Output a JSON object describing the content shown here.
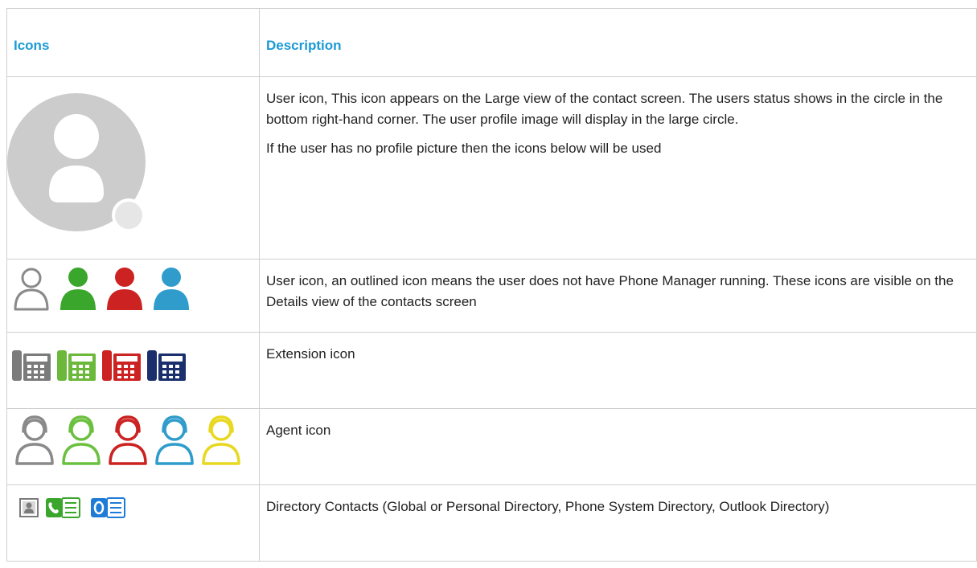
{
  "table": {
    "headers": {
      "icons": "Icons",
      "description": "Description"
    },
    "rows": [
      {
        "icon_set": [
          "user-profile-large-icon"
        ],
        "paragraphs": [
          "User icon, This icon appears on the Large view of the contact screen. The users status shows in the circle in the bottom right-hand corner. The user profile image will display in the large circle.",
          "If the user has no profile picture then the icons below will be used"
        ]
      },
      {
        "icon_set": [
          "user-outline-grey-icon",
          "user-green-icon",
          "user-red-icon",
          "user-blue-icon"
        ],
        "paragraphs": [
          "User icon, an outlined icon means the user does not have Phone Manager running. These icons are visible on the Details view of the contacts screen"
        ]
      },
      {
        "icon_set": [
          "extension-grey-icon",
          "extension-green-icon",
          "extension-red-icon",
          "extension-navy-icon"
        ],
        "paragraphs": [
          "Extension icon"
        ]
      },
      {
        "icon_set": [
          "agent-grey-icon",
          "agent-green-icon",
          "agent-red-icon",
          "agent-blue-icon",
          "agent-yellow-icon"
        ],
        "paragraphs": [
          "Agent icon"
        ]
      },
      {
        "icon_set": [
          "directory-contact-icon",
          "phone-system-directory-icon",
          "outlook-directory-icon"
        ],
        "paragraphs": [
          "Directory Contacts (Global or Personal Directory, Phone System Directory, Outlook Directory)"
        ]
      }
    ]
  },
  "colors": {
    "header_text": "#1a9ad6",
    "grey": "#8a8a8a",
    "green": "#3aa62b",
    "red": "#cc2222",
    "blue": "#2f9ccc",
    "navy": "#1a2f6b",
    "yellow": "#e8d820",
    "light_grey": "#cfcfcf"
  }
}
